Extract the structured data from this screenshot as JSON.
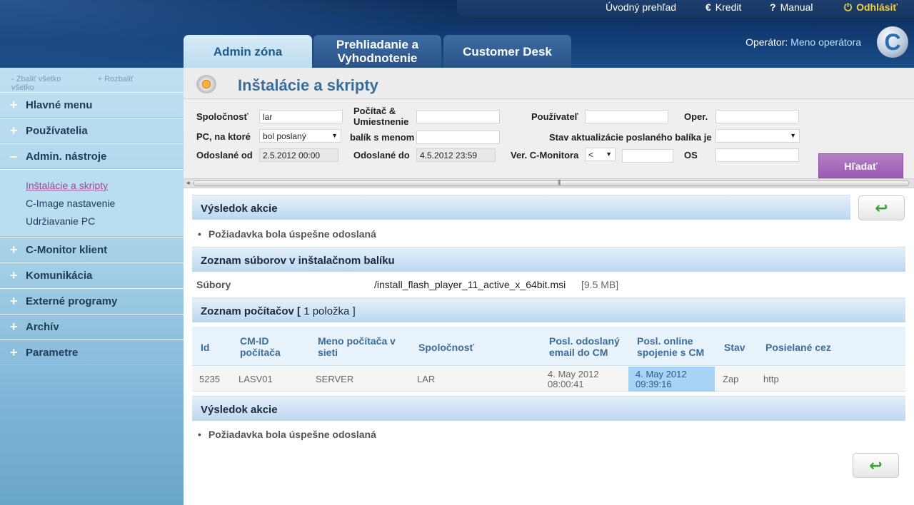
{
  "topnav": {
    "overview": "Úvodný prehľad",
    "credit": "Kredit",
    "manual": "Manual",
    "logout": "Odhlásiť"
  },
  "tabs": [
    {
      "label": "Admin zóna",
      "active": true
    },
    {
      "label": "Prehliadanie a Vyhodnotenie",
      "active": false
    },
    {
      "label": "Customer Desk",
      "active": false
    }
  ],
  "operator": {
    "prefix": "Operátor:",
    "name": "Meno operátora"
  },
  "logo_letter": "C",
  "sidebar": {
    "collapse_all": "Zbaliť všetko",
    "expand_all": "Rozbaliť všetko",
    "items": [
      {
        "label": "Hlavné menu",
        "sign": "+"
      },
      {
        "label": "Používatelia",
        "sign": "+"
      },
      {
        "label": "Admin. nástroje",
        "sign": "–"
      },
      {
        "label": "C-Monitor klient",
        "sign": "+"
      },
      {
        "label": "Komunikácia",
        "sign": "+"
      },
      {
        "label": "Externé programy",
        "sign": "+"
      },
      {
        "label": "Archív",
        "sign": "+"
      },
      {
        "label": "Parametre",
        "sign": "+"
      }
    ],
    "subitems": [
      {
        "label": "Inštalácie a skripty",
        "active": true
      },
      {
        "label": "C-Image nastavenie",
        "active": false
      },
      {
        "label": "Udržiavanie PC",
        "active": false
      }
    ]
  },
  "page_title": "Inštalácie a skripty",
  "filter": {
    "company_label": "Spoločnosť",
    "company_value": "lar",
    "pc_location_label": "Počítač & Umiestnenie",
    "pc_location_value": "",
    "user_label": "Používateľ",
    "user_value": "",
    "oper_label": "Oper.",
    "oper_value": "",
    "pc_which_label": "PC, na ktoré",
    "pc_which_value": "bol poslaný",
    "package_label": "balík s menom",
    "package_value": "",
    "update_status_label": "Stav aktualizácie poslaného balíka je",
    "update_status_value": "",
    "sent_from_label": "Odoslané od",
    "sent_from_value": "2.5.2012 00:00",
    "sent_to_label": "Odoslané do",
    "sent_to_value": "4.5.2012 23:59",
    "cmon_ver_label": "Ver. C-Monitora",
    "cmon_ver_op": "<",
    "cmon_ver_value": "",
    "os_label": "OS",
    "os_value": "",
    "search_button": "Hľadať"
  },
  "result1": {
    "title": "Výsledok akcie",
    "message": "Požiadavka bola úspešne odoslaná"
  },
  "files": {
    "section_title": "Zoznam súborov v inštalačnom balíku",
    "label": "Súbory",
    "name": "/install_flash_player_11_active_x_64bit.msi",
    "size": "[9.5 MB]"
  },
  "computers": {
    "title_prefix": "Zoznam počítačov [ ",
    "count": "1",
    "title_suffix": " položka ]",
    "headers": [
      "Id",
      "CM-ID počítača",
      "Meno počítača v sieti",
      "Spoločnosť",
      "Posl. odoslaný email do CM",
      "Posl. online spojenie s CM",
      "Stav",
      "Posielané cez"
    ],
    "rows": [
      {
        "id": "5235",
        "cmid": "LASV01",
        "name": "SERVER",
        "company": "LAR",
        "last_email": "4. May 2012 08:00:41",
        "last_online": "4. May 2012 09:39:16",
        "status": "Zap",
        "via": "http"
      }
    ]
  },
  "result2": {
    "title": "Výsledok akcie",
    "message": "Požiadavka bola úspešne odoslaná"
  },
  "back_arrow": "↩"
}
